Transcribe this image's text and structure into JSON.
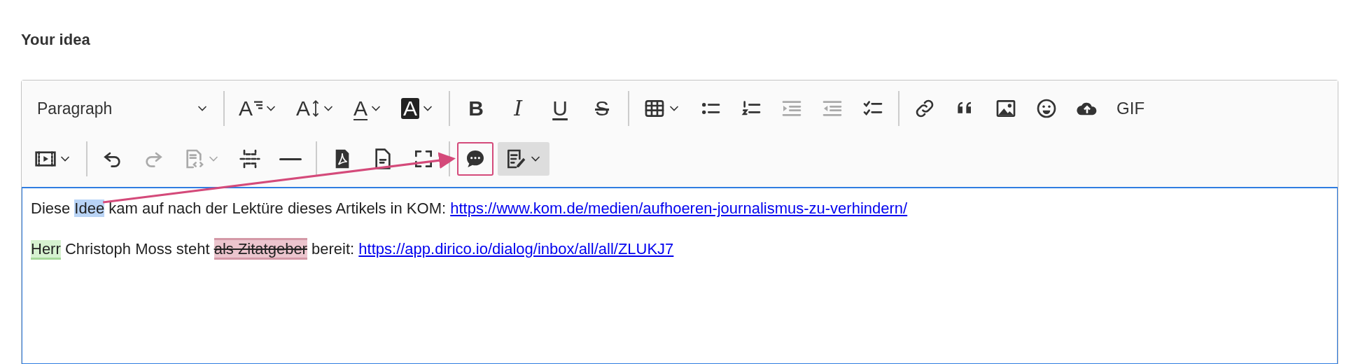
{
  "field_label": "Your idea",
  "toolbar": {
    "rows": [
      [
        {
          "kind": "select",
          "label": "Paragraph"
        },
        {
          "kind": "separator"
        },
        {
          "kind": "dropdown",
          "label": "A",
          "disabled": false
        },
        {
          "kind": "dropdown",
          "label": "A",
          "disabled": false
        },
        {
          "kind": "dropdown",
          "label": "A",
          "disabled": false
        },
        {
          "kind": "dropdown",
          "label": "A",
          "disabled": false
        },
        {
          "kind": "separator"
        },
        {
          "kind": "glyph",
          "label": "B",
          "disabled": false
        },
        {
          "kind": "glyph",
          "label": "I",
          "disabled": false
        },
        {
          "kind": "glyph",
          "label": "U",
          "disabled": false
        },
        {
          "kind": "glyph",
          "label": "S",
          "disabled": false
        },
        {
          "kind": "separator"
        },
        {
          "kind": "dropdown",
          "disabled": false
        },
        {
          "kind": "button",
          "disabled": false
        },
        {
          "kind": "button",
          "disabled": false
        },
        {
          "kind": "button",
          "disabled": true
        },
        {
          "kind": "button",
          "disabled": true
        },
        {
          "kind": "button",
          "disabled": false
        },
        {
          "kind": "separator"
        },
        {
          "kind": "button",
          "disabled": false
        },
        {
          "kind": "button",
          "disabled": false
        },
        {
          "kind": "button",
          "disabled": false
        },
        {
          "kind": "button",
          "disabled": false
        },
        {
          "kind": "button",
          "disabled": false
        },
        {
          "kind": "text",
          "label": "GIF",
          "disabled": false
        }
      ],
      [
        {
          "kind": "dropdown",
          "disabled": false
        },
        {
          "kind": "separator"
        },
        {
          "kind": "button",
          "disabled": false
        },
        {
          "kind": "button",
          "disabled": true
        },
        {
          "kind": "dropdown",
          "disabled": true
        },
        {
          "kind": "button",
          "disabled": false
        },
        {
          "kind": "button",
          "disabled": false
        },
        {
          "kind": "separator"
        },
        {
          "kind": "button",
          "disabled": false
        },
        {
          "kind": "button",
          "disabled": false
        },
        {
          "kind": "button",
          "disabled": false
        },
        {
          "kind": "separator"
        },
        {
          "kind": "button",
          "disabled": false,
          "highlighted": true
        },
        {
          "kind": "dropdown",
          "disabled": false,
          "on": true
        }
      ]
    ]
  },
  "paragraphs": [
    [
      {
        "kind": "text",
        "text": "Diese "
      },
      {
        "kind": "marker",
        "text": "Idee",
        "arrow": true
      },
      {
        "kind": "text",
        "text": " kam auf nach der Lektüre dieses Artikels in KOM: "
      },
      {
        "kind": "link",
        "text": "https://www.kom.de/medien/aufhoeren-journalismus-zu-verhindern/"
      }
    ],
    [
      {
        "kind": "insertion",
        "text": "Herr"
      },
      {
        "kind": "text",
        "text": " Christoph Moss steht "
      },
      {
        "kind": "deletion",
        "text": "als Zitatgeber"
      },
      {
        "kind": "text",
        "text": " bereit: "
      },
      {
        "kind": "link",
        "text": "https://app.dirico.io/dialog/inbox/all/all/ZLUKJ7"
      }
    ]
  ]
}
